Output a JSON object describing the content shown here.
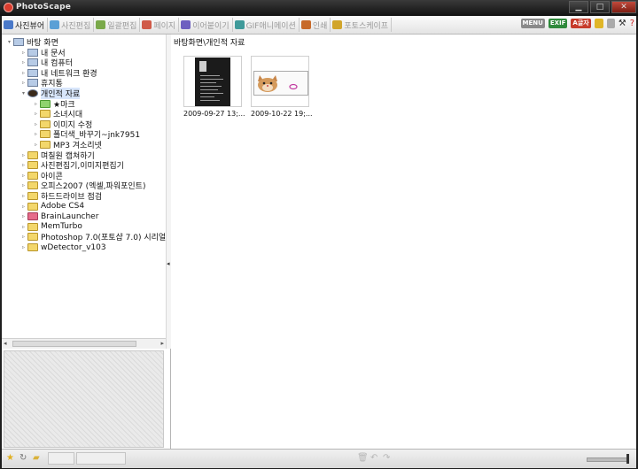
{
  "window": {
    "title": "PhotoScape"
  },
  "toolbar": {
    "tabs": [
      {
        "label": "사진뷰어",
        "active": true,
        "color": "#4a79c9"
      },
      {
        "label": "사진편집",
        "active": false,
        "color": "#5aa0d6"
      },
      {
        "label": "일괄편집",
        "active": false,
        "color": "#7aa94a"
      },
      {
        "label": "페이지",
        "active": false,
        "color": "#d05a48"
      },
      {
        "label": "이어붙이기",
        "active": false,
        "color": "#6e5fc0"
      },
      {
        "label": "GIF애니메이션",
        "active": false,
        "color": "#3f9a9a"
      },
      {
        "label": "인쇄",
        "active": false,
        "color": "#c76a2a"
      },
      {
        "label": "포토스케이프",
        "active": false,
        "color": "#d1a52b"
      }
    ],
    "right_icons": {
      "menu": "MENU",
      "exif": "EXIF",
      "korean": "A글자"
    }
  },
  "tree": [
    {
      "label": "바탕 화면",
      "level": 0,
      "icon": "desktop-icon",
      "expanded": true
    },
    {
      "label": "내 문서",
      "level": 1,
      "icon": "documents-icon"
    },
    {
      "label": "내 컴퓨터",
      "level": 1,
      "icon": "computer-icon"
    },
    {
      "label": "내 네트워크 환경",
      "level": 1,
      "icon": "network-icon"
    },
    {
      "label": "휴지통",
      "level": 1,
      "icon": "recycle-bin-icon"
    },
    {
      "label": "개인적 자료",
      "level": 1,
      "icon": "user-icon",
      "selected": true,
      "expanded": true
    },
    {
      "label": "★마크",
      "level": 2,
      "icon": "folder-icon",
      "color": "green"
    },
    {
      "label": "소녀시대",
      "level": 2,
      "icon": "folder-icon"
    },
    {
      "label": "이미지 수정",
      "level": 2,
      "icon": "folder-icon"
    },
    {
      "label": "폴더색_바꾸기~jnk7951",
      "level": 2,
      "icon": "folder-icon"
    },
    {
      "label": "MP3 겨소리넷",
      "level": 2,
      "icon": "folder-icon"
    },
    {
      "label": "며칠원 캡쳐하기",
      "level": 1,
      "icon": "folder-icon"
    },
    {
      "label": "사진편집기,이미지편집기",
      "level": 1,
      "icon": "folder-icon"
    },
    {
      "label": "아이콘",
      "level": 1,
      "icon": "folder-icon"
    },
    {
      "label": "오피스2007 (엑셀,파워포인트)",
      "level": 1,
      "icon": "folder-icon"
    },
    {
      "label": "하드드라이브 점검",
      "level": 1,
      "icon": "folder-icon"
    },
    {
      "label": "Adobe CS4",
      "level": 1,
      "icon": "folder-icon"
    },
    {
      "label": "BrainLauncher",
      "level": 1,
      "icon": "folder-icon",
      "color": "pink"
    },
    {
      "label": "MemTurbo",
      "level": 1,
      "icon": "folder-icon"
    },
    {
      "label": "Photoshop 7.0(포토샵 7.0) 시리얼",
      "level": 1,
      "icon": "folder-icon"
    },
    {
      "label": "wDetector_v103",
      "level": 1,
      "icon": "folder-icon"
    }
  ],
  "main": {
    "path": "바탕화면\\개인적 자료",
    "thumbnails": [
      {
        "caption": "2009-09-27 13;..."
      },
      {
        "caption": "2009-10-22 19;..."
      }
    ]
  }
}
